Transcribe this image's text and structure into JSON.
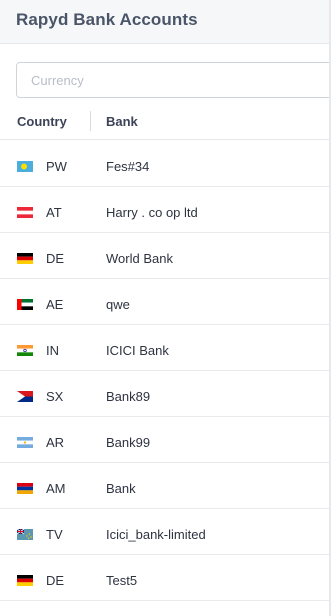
{
  "header": {
    "title": "Rapyd Bank Accounts"
  },
  "search": {
    "placeholder": "Currency",
    "value": ""
  },
  "table": {
    "columns": {
      "country": "Country",
      "bank": "Bank"
    },
    "rows": [
      {
        "code": "PW",
        "bank": "Fes#34",
        "flag": "palau-flag-icon"
      },
      {
        "code": "AT",
        "bank": "Harry . co op ltd",
        "flag": "austria-flag-icon"
      },
      {
        "code": "DE",
        "bank": "World Bank",
        "flag": "germany-flag-icon"
      },
      {
        "code": "AE",
        "bank": "qwe",
        "flag": "uae-flag-icon"
      },
      {
        "code": "IN",
        "bank": "ICICI Bank",
        "flag": "india-flag-icon"
      },
      {
        "code": "SX",
        "bank": "Bank89",
        "flag": "sint-maarten-flag-icon"
      },
      {
        "code": "AR",
        "bank": "Bank99",
        "flag": "argentina-flag-icon"
      },
      {
        "code": "AM",
        "bank": "Bank",
        "flag": "armenia-flag-icon"
      },
      {
        "code": "TV",
        "bank": "Icici_bank-limited",
        "flag": "tuvalu-flag-icon"
      },
      {
        "code": "DE",
        "bank": "Test5",
        "flag": "germany-flag-icon"
      }
    ]
  }
}
